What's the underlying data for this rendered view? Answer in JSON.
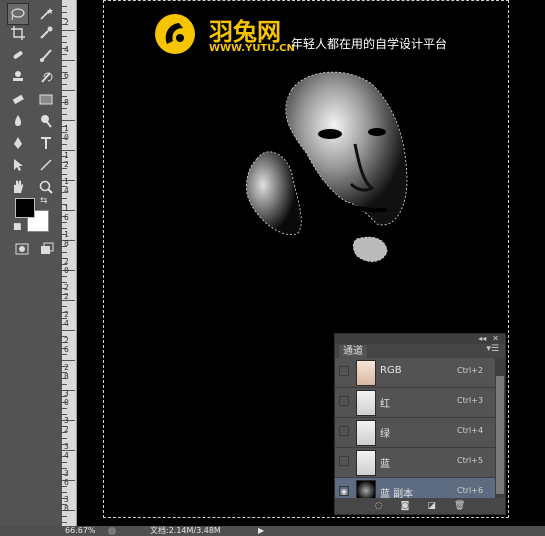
{
  "toolbar": {
    "rows": [
      {
        "left": "lasso-icon",
        "right": "magic-wand-icon"
      },
      {
        "left": "crop-icon",
        "right": "eyedropper-icon"
      },
      {
        "left": "healing-brush-icon",
        "right": "brush-icon"
      },
      {
        "left": "stamp-icon",
        "right": "history-brush-icon"
      },
      {
        "left": "eraser-icon",
        "right": "gradient-icon"
      },
      {
        "left": "blur-icon",
        "right": "dodge-icon"
      },
      {
        "left": "pen-icon",
        "right": "text-icon"
      },
      {
        "left": "path-select-icon",
        "right": "line-icon"
      },
      {
        "left": "hand-icon",
        "right": "zoom-icon"
      }
    ],
    "foreground_color": "#000000",
    "background_color": "#ffffff"
  },
  "ruler": {
    "labels": [
      "2",
      "4",
      "6",
      "8",
      "1 0",
      "1 2",
      "1 4",
      "1 6",
      "1 8",
      "2 0",
      "2 2",
      "2 4",
      "2 6",
      "2 8",
      "3 0",
      "3 2",
      "3 4",
      "3 6",
      "3 8"
    ]
  },
  "watermark": {
    "name": "羽兔网",
    "url": "WWW.YUTU.CN",
    "slogan": "年轻人都在用的自学设计平台",
    "brand_color": "#f6c500"
  },
  "channels_panel": {
    "tab_label": "通道",
    "rows": [
      {
        "name": "RGB",
        "shortcut": "Ctrl+2",
        "visible": false
      },
      {
        "name": "红",
        "shortcut": "Ctrl+3",
        "visible": false
      },
      {
        "name": "绿",
        "shortcut": "Ctrl+4",
        "visible": false
      },
      {
        "name": "蓝",
        "shortcut": "Ctrl+5",
        "visible": false
      },
      {
        "name": "蓝 副本",
        "shortcut": "Ctrl+6",
        "visible": true,
        "selected": true
      }
    ],
    "bottom_icons": [
      "dotted-circle-icon",
      "save-selection-icon",
      "new-channel-icon",
      "trash-icon"
    ]
  },
  "status": {
    "zoom": "66.67%",
    "doc": "文档:2.14M/3.48M"
  }
}
